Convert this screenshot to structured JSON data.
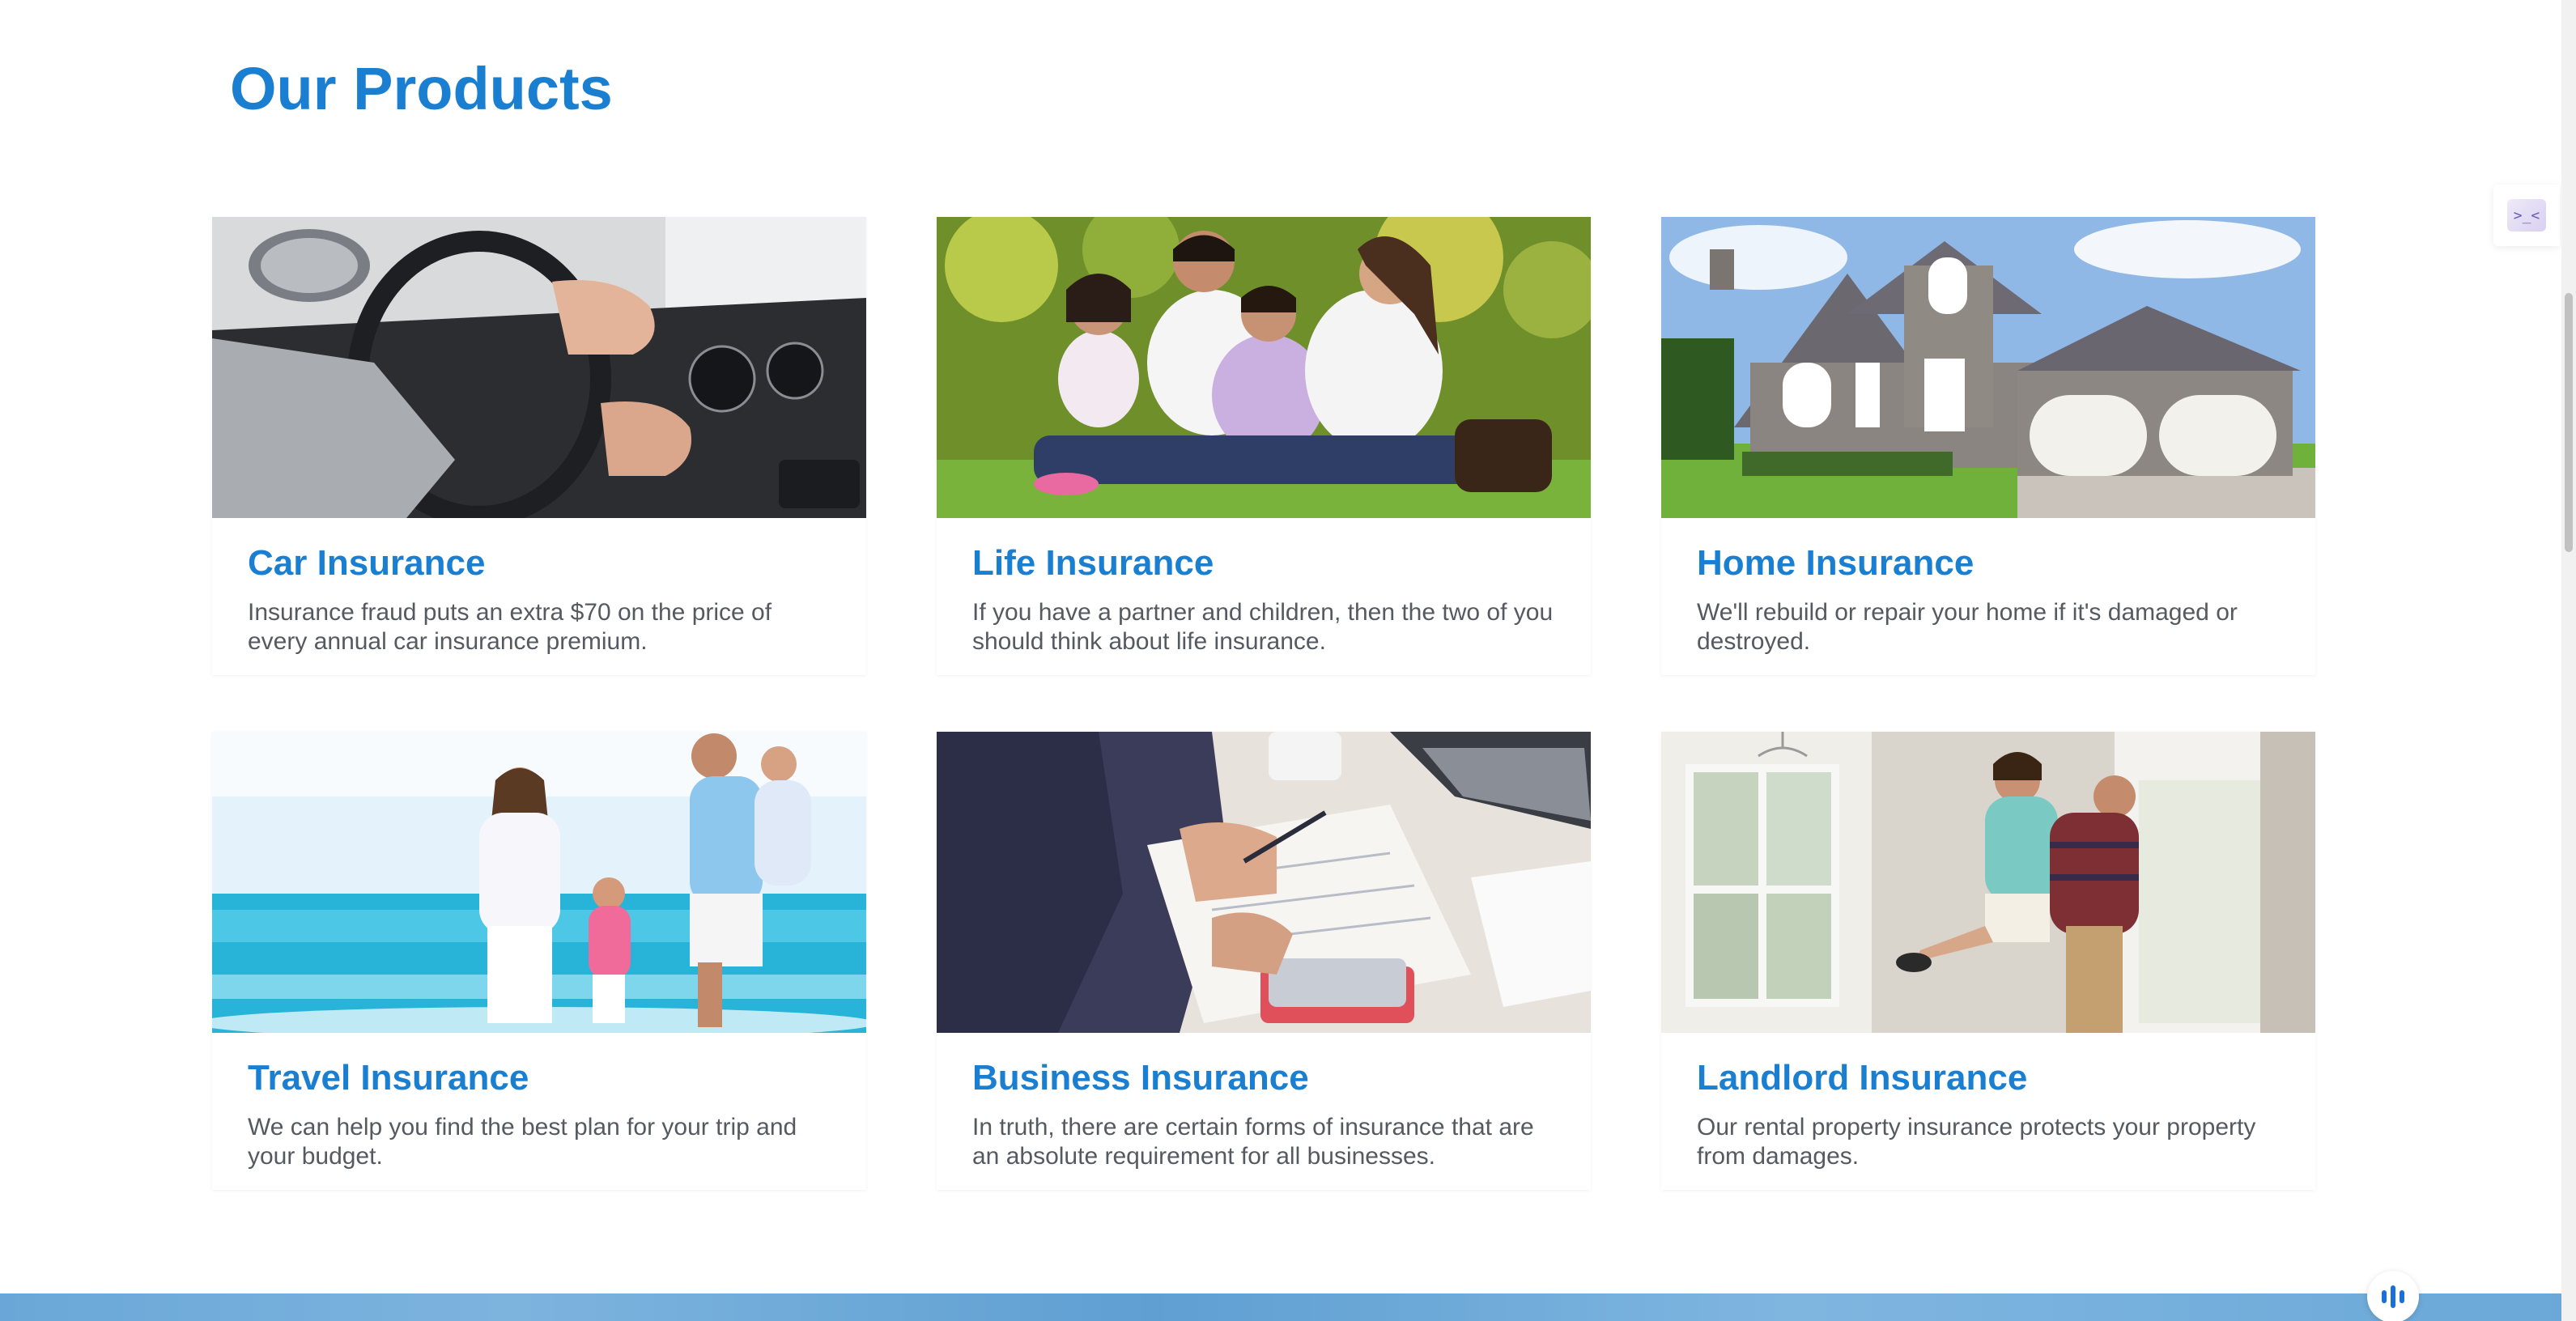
{
  "section": {
    "title": "Our Products"
  },
  "products": [
    {
      "title": "Car Insurance",
      "description": "Insurance fraud puts an extra $70 on the price of every annual car insurance premium.",
      "image_icon": "car-steering-photo"
    },
    {
      "title": "Life Insurance",
      "description": "If you have a partner and children, then the two of you should think about life insurance.",
      "image_icon": "family-on-grass-photo"
    },
    {
      "title": "Home Insurance",
      "description": "We'll rebuild or repair your home if it's damaged or destroyed.",
      "image_icon": "stone-house-photo"
    },
    {
      "title": "Travel Insurance",
      "description": "We can help you find the best plan for your trip and your budget.",
      "image_icon": "family-on-beach-photo"
    },
    {
      "title": "Business Insurance",
      "description": "In truth, there are certain forms of insurance that are an absolute requirement for all businesses.",
      "image_icon": "business-paperwork-photo"
    },
    {
      "title": "Landlord Insurance",
      "description": "Our rental property insurance protects your property from damages.",
      "image_icon": "couple-new-home-photo"
    }
  ],
  "widgets": {
    "side_widget_icon": "code-assistant-icon",
    "voice_button_icon": "voice-wave-icon"
  },
  "colors": {
    "accent": "#1a7fd1",
    "body_text": "#555a60",
    "background": "#ffffff"
  }
}
